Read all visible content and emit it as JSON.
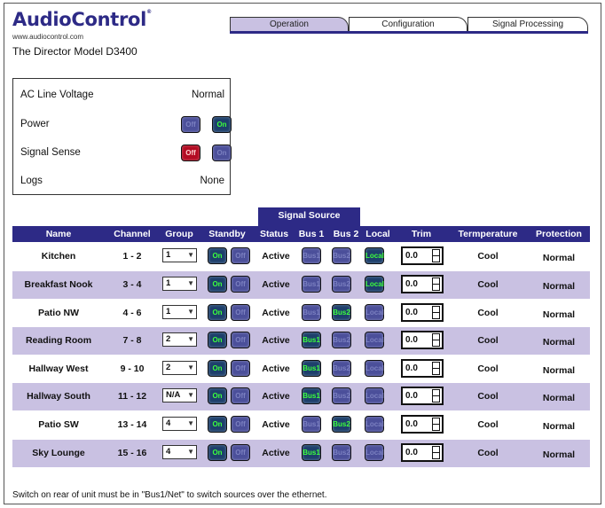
{
  "header": {
    "logo": "AudioControl",
    "website": "www.audiocontrol.com",
    "model": "The Director Model D3400"
  },
  "tabs": [
    {
      "label": "Operation",
      "active": true
    },
    {
      "label": "Configuration",
      "active": false
    },
    {
      "label": "Signal Processing",
      "active": false
    }
  ],
  "status": {
    "ac_line_voltage_label": "AC Line Voltage",
    "ac_line_voltage_value": "Normal",
    "power_label": "Power",
    "power_off": "Off",
    "power_on": "On",
    "signal_sense_label": "Signal Sense",
    "signal_sense_off": "Off",
    "signal_sense_on": "On",
    "logs_label": "Logs",
    "logs_value": "None"
  },
  "table": {
    "signal_source_header": "Signal Source",
    "columns": [
      "Name",
      "Channel",
      "Group",
      "Standby",
      "Status",
      "Bus 1",
      "Bus 2",
      "Local",
      "Trim",
      "Termperature",
      "Protection"
    ],
    "rows": [
      {
        "name": "Kitchen",
        "channel": "1 - 2",
        "group": "1",
        "standby_on": "On",
        "standby_off": "Off",
        "status": "Active",
        "bus1": "Bus1",
        "bus2": "Bus2",
        "local": "Local",
        "source": "local",
        "trim": "0.0",
        "temperature": "Cool",
        "protection": "Normal"
      },
      {
        "name": "Breakfast Nook",
        "channel": "3 - 4",
        "group": "1",
        "standby_on": "On",
        "standby_off": "Off",
        "status": "Active",
        "bus1": "Bus1",
        "bus2": "Bus2",
        "local": "Local",
        "source": "local",
        "trim": "0.0",
        "temperature": "Cool",
        "protection": "Normal"
      },
      {
        "name": "Patio NW",
        "channel": "4 - 6",
        "group": "1",
        "standby_on": "On",
        "standby_off": "Off",
        "status": "Active",
        "bus1": "Bus1",
        "bus2": "Bus2",
        "local": "Local",
        "source": "bus2",
        "trim": "0.0",
        "temperature": "Cool",
        "protection": "Normal"
      },
      {
        "name": "Reading Room",
        "channel": "7 - 8",
        "group": "2",
        "standby_on": "On",
        "standby_off": "Off",
        "status": "Active",
        "bus1": "Bus1",
        "bus2": "Bus2",
        "local": "Local",
        "source": "bus1",
        "trim": "0.0",
        "temperature": "Cool",
        "protection": "Normal"
      },
      {
        "name": "Hallway West",
        "channel": "9 - 10",
        "group": "2",
        "standby_on": "On",
        "standby_off": "Off",
        "status": "Active",
        "bus1": "Bus1",
        "bus2": "Bus2",
        "local": "Local",
        "source": "bus1",
        "trim": "0.0",
        "temperature": "Cool",
        "protection": "Normal"
      },
      {
        "name": "Hallway South",
        "channel": "11 - 12",
        "group": "N/A",
        "standby_on": "On",
        "standby_off": "Off",
        "status": "Active",
        "bus1": "Bus1",
        "bus2": "Bus2",
        "local": "Local",
        "source": "bus1",
        "trim": "0.0",
        "temperature": "Cool",
        "protection": "Normal"
      },
      {
        "name": "Patio SW",
        "channel": "13 - 14",
        "group": "4",
        "standby_on": "On",
        "standby_off": "Off",
        "status": "Active",
        "bus1": "Bus1",
        "bus2": "Bus2",
        "local": "Local",
        "source": "bus2",
        "trim": "0.0",
        "temperature": "Cool",
        "protection": "Normal"
      },
      {
        "name": "Sky Lounge",
        "channel": "15 - 16",
        "group": "4",
        "standby_on": "On",
        "standby_off": "Off",
        "status": "Active",
        "bus1": "Bus1",
        "bus2": "Bus2",
        "local": "Local",
        "source": "bus1",
        "trim": "0.0",
        "temperature": "Cool",
        "protection": "Normal"
      }
    ]
  },
  "footnote": "Switch on rear of unit must be in \"Bus1/Net\" to switch sources over the ethernet.",
  "colors": {
    "brand": "#2d2a86",
    "row_alt": "#c9c1e2",
    "led_on": "#3cff3c",
    "alarm_red": "#b30b22"
  }
}
